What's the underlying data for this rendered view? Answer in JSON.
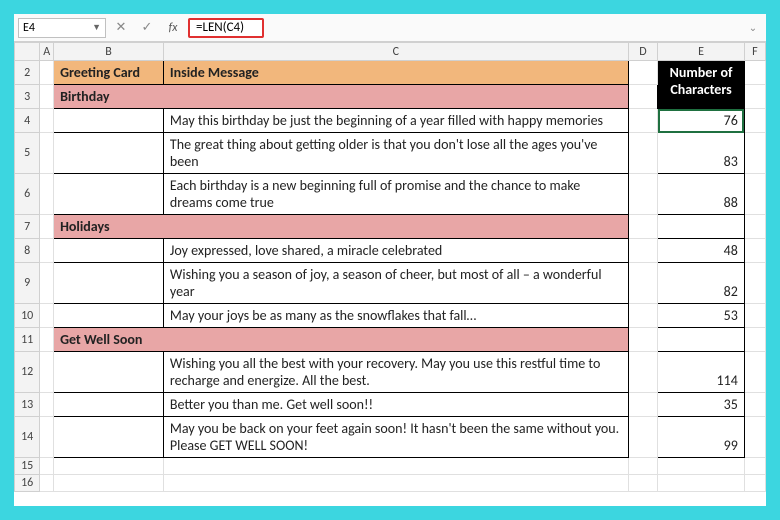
{
  "namebox": "E4",
  "formula": "=LEN(C4)",
  "columns": [
    "A",
    "B",
    "C",
    "D",
    "E",
    "F"
  ],
  "header": {
    "greeting": "Greeting Card",
    "inside": "Inside Message",
    "numchars_l1": "Number of",
    "numchars_l2": "Characters"
  },
  "categories": {
    "birthday": "Birthday",
    "holidays": "Holidays",
    "getwell": "Get Well Soon"
  },
  "rows": {
    "r4_msg": "May this birthday be just the beginning of a year filled with happy memories",
    "r4_len": "76",
    "r5_msg": "The great thing about getting older is that you don't lose all the ages you've been",
    "r5_len": "83",
    "r6_msg": "Each birthday is a new beginning full of promise and the chance to make dreams come true",
    "r6_len": "88",
    "r8_msg": "Joy expressed, love shared, a miracle celebrated",
    "r8_len": "48",
    "r9_msg": "Wishing you a season of joy, a season of cheer, but most of all – a wonderful year",
    "r9_len": "82",
    "r10_msg": "May your joys be as many as the snowflakes that fall…",
    "r10_len": "53",
    "r12_msg": "Wishing you all the best with your recovery. May you use this restful time to recharge and energize. All the best.",
    "r12_len": "114",
    "r13_msg": "Better you than me. Get well soon!!",
    "r13_len": "35",
    "r14_msg": "May you be back on your feet again soon! It hasn't been the same without you. Please GET WELL SOON!",
    "r14_len": "99"
  },
  "rownums": [
    "2",
    "3",
    "4",
    "5",
    "6",
    "7",
    "8",
    "9",
    "10",
    "11",
    "12",
    "13",
    "14",
    "15",
    "16"
  ]
}
